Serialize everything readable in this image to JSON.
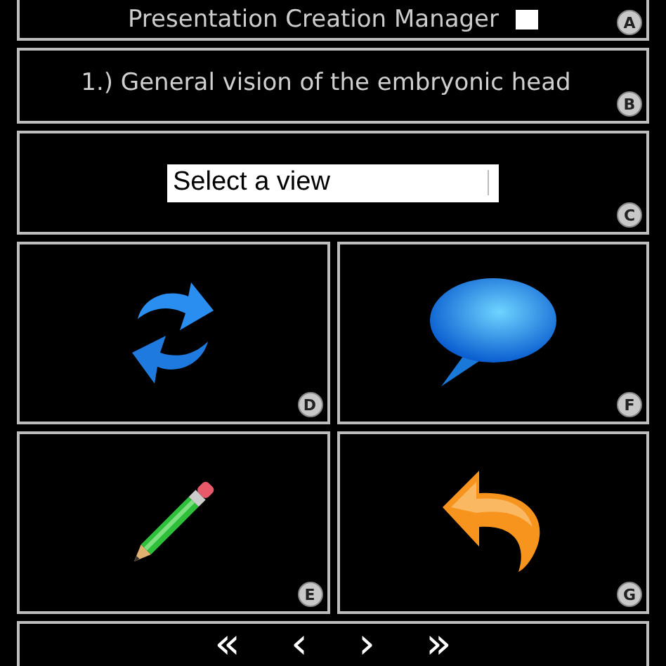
{
  "header": {
    "title": "Presentation Creation Manager",
    "checked": false,
    "badge": "A"
  },
  "section": {
    "title": "1.) General vision of the embryonic head",
    "badge": "B"
  },
  "view_select": {
    "placeholder": "Select a view",
    "badge": "C"
  },
  "tiles": [
    {
      "kind": "refresh",
      "badge": "D"
    },
    {
      "kind": "speech",
      "badge": "F"
    },
    {
      "kind": "pencil",
      "badge": "E"
    },
    {
      "kind": "undo",
      "badge": "G"
    }
  ],
  "navigation": [
    "«",
    "‹",
    "›",
    "»"
  ]
}
